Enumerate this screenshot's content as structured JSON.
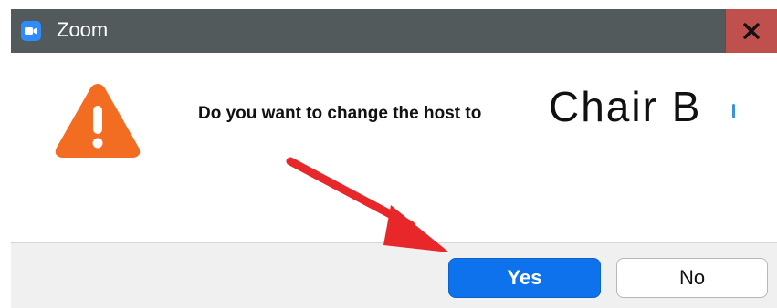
{
  "window": {
    "title": "Zoom",
    "close_glyph": "x",
    "accent_color": "#2d8cff",
    "close_color": "#c0504d"
  },
  "dialog": {
    "icon": "warning-triangle-icon",
    "icon_color": "#f26d21",
    "question": "Do you want to change the host to",
    "participant_name": "Chair B"
  },
  "buttons": {
    "yes_label": "Yes",
    "no_label": "No",
    "yes_color": "#0e72ed"
  },
  "annotation": {
    "arrow_color": "#e8272a",
    "arrow_icon": "red-arrow-icon"
  }
}
